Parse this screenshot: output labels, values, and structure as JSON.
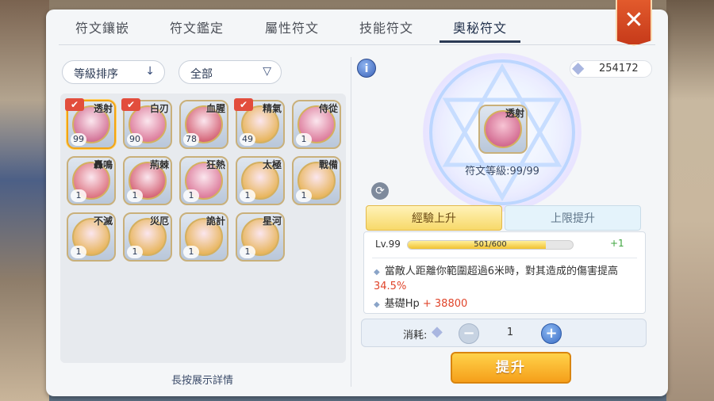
{
  "tabs": [
    {
      "label": "符文鑲嵌",
      "active": false
    },
    {
      "label": "符文鑑定",
      "active": false
    },
    {
      "label": "屬性符文",
      "active": false
    },
    {
      "label": "技能符文",
      "active": false
    },
    {
      "label": "奧秘符文",
      "active": true
    }
  ],
  "close_icon": "close-icon",
  "filters": {
    "sort_label": "等級排序",
    "sort_icon": "arrow-down-icon",
    "category_label": "全部",
    "category_icon": "chevron-down-icon"
  },
  "runes": [
    {
      "name": "透射",
      "level": "99",
      "equipped": true,
      "selected": true,
      "color": "#c54a78"
    },
    {
      "name": "白刃",
      "level": "90",
      "equipped": true,
      "selected": false,
      "color": "#d2577f"
    },
    {
      "name": "血腥",
      "level": "78",
      "equipped": false,
      "selected": false,
      "color": "#c8384f"
    },
    {
      "name": "精氣",
      "level": "49",
      "equipped": true,
      "selected": false,
      "color": "#e1a42a"
    },
    {
      "name": "侍從",
      "level": "1",
      "equipped": false,
      "selected": false,
      "color": "#d2577f"
    },
    {
      "name": "轟鳴",
      "level": "1",
      "equipped": false,
      "selected": false,
      "color": "#d24c5c"
    },
    {
      "name": "荊棘",
      "level": "1",
      "equipped": false,
      "selected": false,
      "color": "#c8384f"
    },
    {
      "name": "狂熱",
      "level": "1",
      "equipped": false,
      "selected": false,
      "color": "#d2577f"
    },
    {
      "name": "太極",
      "level": "1",
      "equipped": false,
      "selected": false,
      "color": "#e1a42a"
    },
    {
      "name": "戰備",
      "level": "1",
      "equipped": false,
      "selected": false,
      "color": "#e1a42a"
    },
    {
      "name": "不滅",
      "level": "1",
      "equipped": false,
      "selected": false,
      "color": "#e1a42a"
    },
    {
      "name": "災厄",
      "level": "1",
      "equipped": false,
      "selected": false,
      "color": "#e1a42a"
    },
    {
      "name": "詭計",
      "level": "1",
      "equipped": false,
      "selected": false,
      "color": "#e1a42a"
    },
    {
      "name": "星河",
      "level": "1",
      "equipped": false,
      "selected": false,
      "color": "#e1a42a"
    }
  ],
  "hint": "長按展示詳情",
  "currency": {
    "amount": "254172",
    "icon": "crystal-icon"
  },
  "selected_rune": {
    "name": "透射",
    "level_text": "符文等級:99/99"
  },
  "sub_tabs": {
    "exp_up": "經驗上升",
    "cap_up": "上限提升"
  },
  "detail": {
    "level_label": "Lv.99",
    "exp_text": "501/600",
    "exp_progress": 0.835,
    "exp_gain": "+1",
    "effect_text": "當敵人距離你範圍超過6米時，對其造成的傷害提高",
    "effect_value": "34.5%",
    "hp_label": "基礎Hp",
    "hp_value": "+ 38800"
  },
  "cost": {
    "label": "消耗:",
    "quantity": "1",
    "minus": "−",
    "plus": "+"
  },
  "upgrade_label": "提升",
  "colors": {
    "accent": "#f59f1a",
    "tab_active": "#2b3a55",
    "positive": "#3fa53f",
    "highlight": "#e0442a"
  }
}
